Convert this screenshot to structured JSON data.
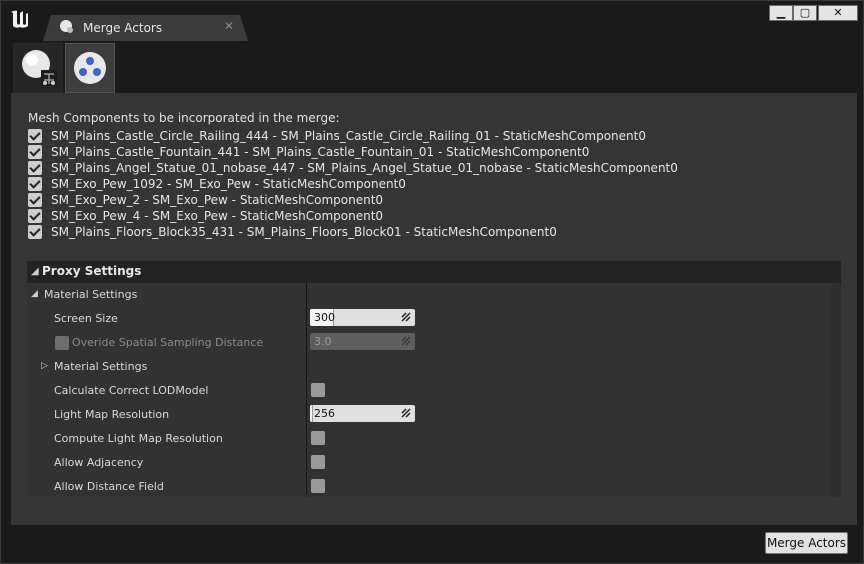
{
  "tab": {
    "title": "Merge Actors",
    "close": "✕"
  },
  "window_controls": {
    "minimize": "▁",
    "maximize": "▢",
    "close": "✕"
  },
  "mesh": {
    "heading": "Mesh Components to be incorporated in the merge:",
    "items": [
      {
        "label": "SM_Plains_Castle_Circle_Railing_444 - SM_Plains_Castle_Circle_Railing_01 - StaticMeshComponent0",
        "checked": true
      },
      {
        "label": "SM_Plains_Castle_Fountain_441 - SM_Plains_Castle_Fountain_01 - StaticMeshComponent0",
        "checked": true
      },
      {
        "label": "SM_Plains_Angel_Statue_01_nobase_447 - SM_Plains_Angel_Statue_01_nobase - StaticMeshComponent0",
        "checked": true
      },
      {
        "label": "SM_Exo_Pew_1092 - SM_Exo_Pew - StaticMeshComponent0",
        "checked": true
      },
      {
        "label": "SM_Exo_Pew_2 - SM_Exo_Pew - StaticMeshComponent0",
        "checked": true
      },
      {
        "label": "SM_Exo_Pew_4 - SM_Exo_Pew - StaticMeshComponent0",
        "checked": true
      },
      {
        "label": "SM_Plains_Floors_Block35_431 - SM_Plains_Floors_Block01 - StaticMeshComponent0",
        "checked": true
      }
    ]
  },
  "proxy": {
    "title": "Proxy Settings",
    "material_settings": "Material Settings",
    "screen_size_label": "Screen Size",
    "screen_size_value": "300",
    "override_spatial_label": "Overide Spatial Sampling Distance",
    "override_spatial_value": "3.0",
    "sub_material_settings": "Material Settings",
    "calc_lod_label": "Calculate Correct LODModel",
    "light_map_res_label": "Light Map Resolution",
    "light_map_res_value": "256",
    "compute_light_map_label": "Compute Light Map Resolution",
    "allow_adjacency_label": "Allow Adjacency",
    "allow_distance_field_label": "Allow Distance Field"
  },
  "footer": {
    "merge_button": "Merge Actors"
  }
}
